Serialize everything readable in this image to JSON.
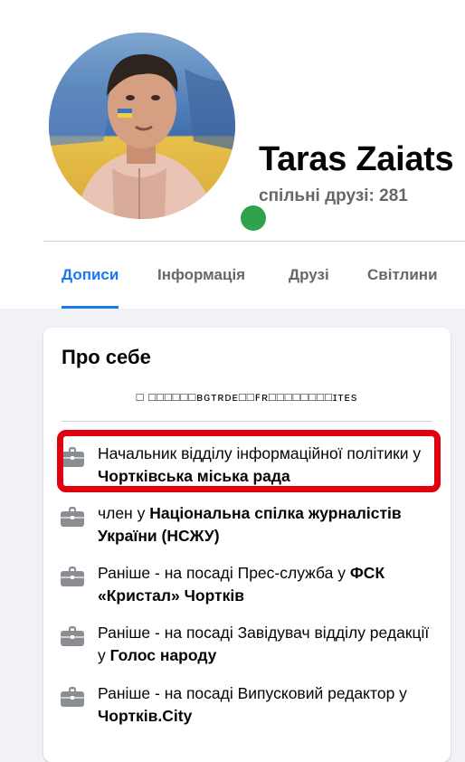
{
  "profile": {
    "name": "Taras Zaiats",
    "mutual_friends": "спільні друзі: 281"
  },
  "tabs": [
    {
      "label": "Дописи",
      "active": true
    },
    {
      "label": "Інформація",
      "active": false
    },
    {
      "label": "Друзі",
      "active": false
    },
    {
      "label": "Світлини",
      "active": false
    }
  ],
  "about": {
    "title": "Про себе",
    "bio": "□ □□□□□□ʙɢᴛʀᴅᴇ□□ꜰʀ□□□□□□□□ɪᴛᴇs",
    "items": [
      {
        "before": "Начальник відділу інформаційної політики у ",
        "bold": "Чортківська міська рада",
        "after": ""
      },
      {
        "before": "член у ",
        "bold": "Національна спілка журналістів України (НСЖУ)",
        "after": ""
      },
      {
        "before": "Раніше - на посаді Прес-служба у ",
        "bold": "ФСК «Кристал» Чортків",
        "after": ""
      },
      {
        "before": "Раніше - на посаді Завідувач відділу редакції у ",
        "bold": "Голос народу",
        "after": ""
      },
      {
        "before": "Раніше - на посаді Випусковий редактор у ",
        "bold": "Чортків.City",
        "after": ""
      }
    ]
  },
  "colors": {
    "accent": "#1877f2",
    "online": "#31a24c",
    "highlight": "#e1000f",
    "secondary_text": "#65676b"
  },
  "icons": {
    "work": "briefcase-icon",
    "online": "online-status-icon"
  }
}
